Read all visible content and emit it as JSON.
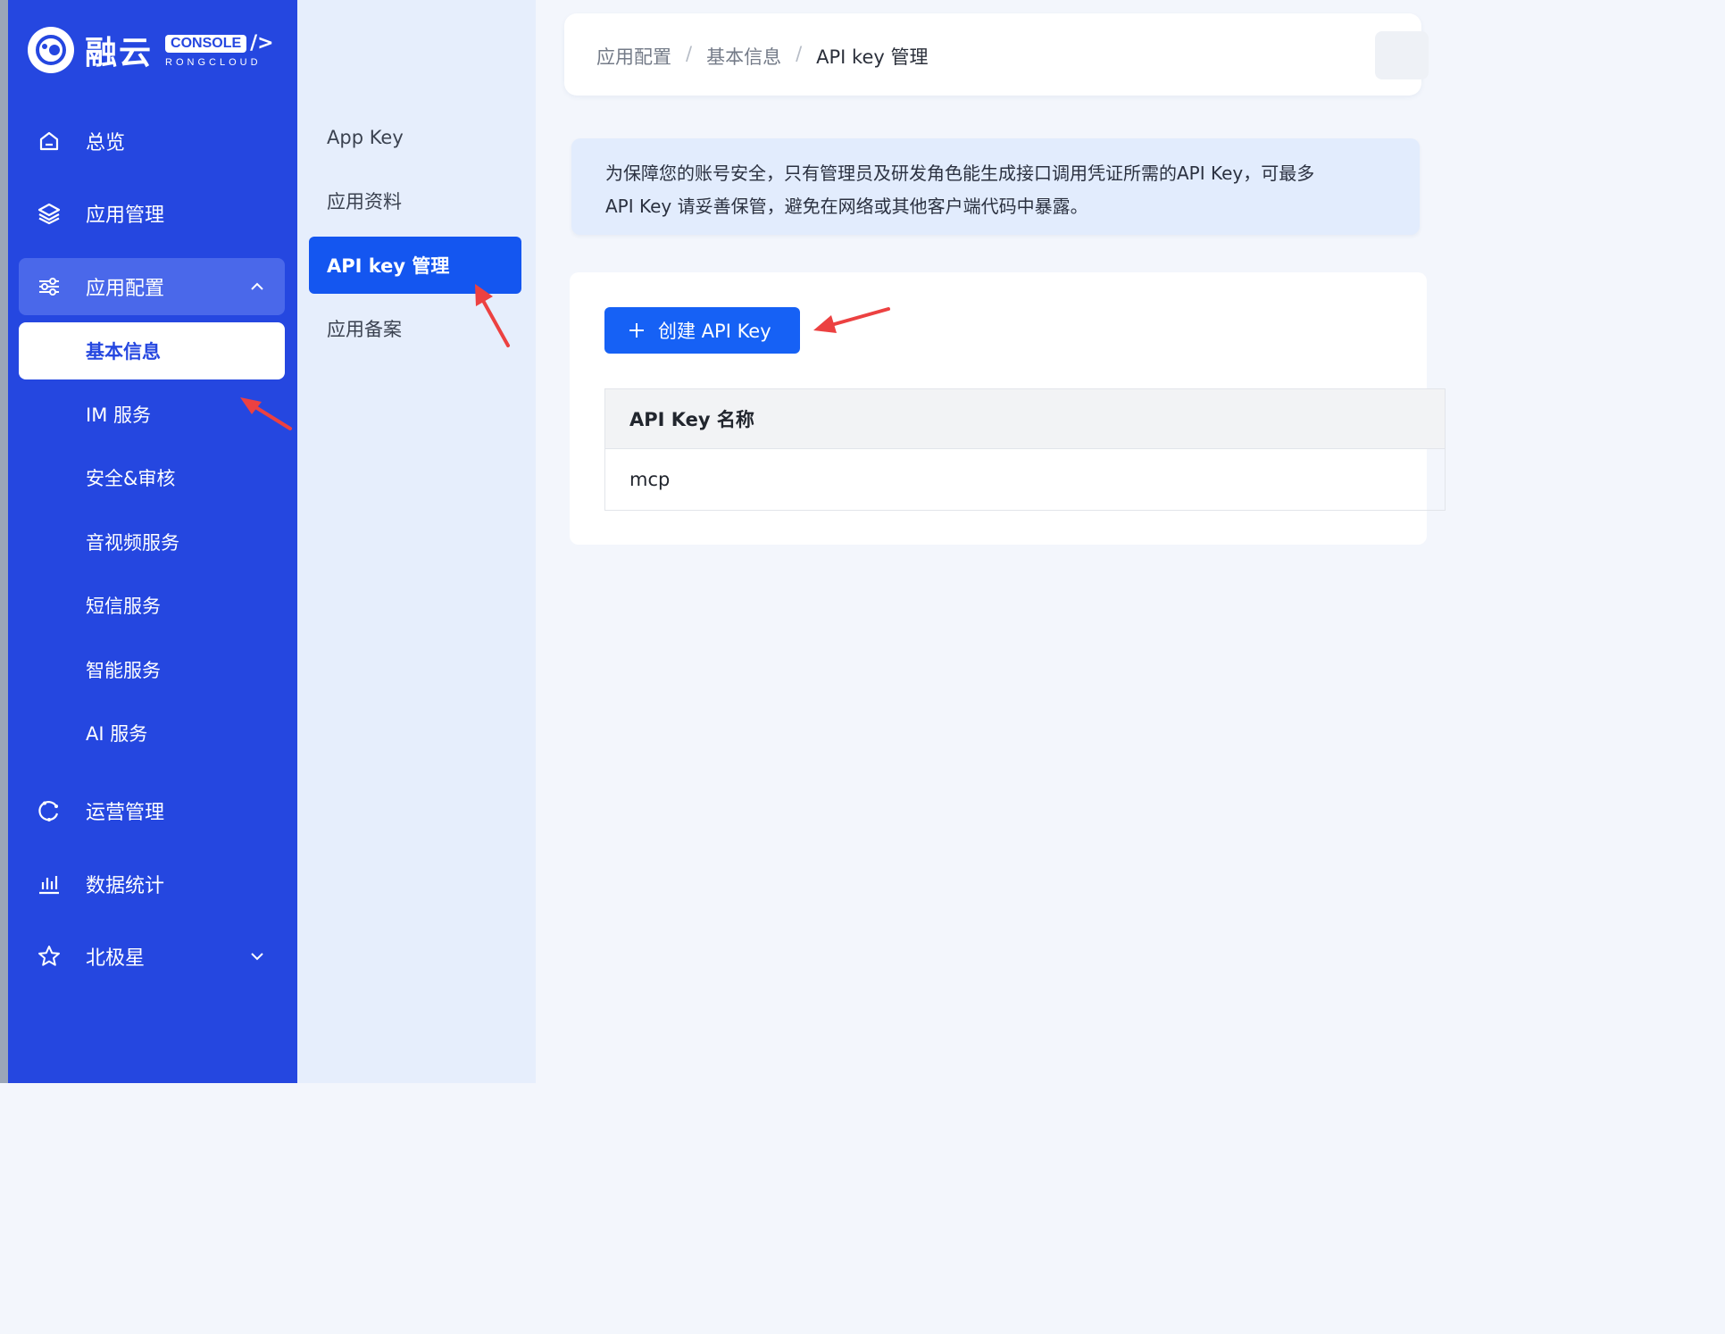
{
  "brand": {
    "name": "融云",
    "console_label": "CONSOLE",
    "console_sub": "RONGCLOUD"
  },
  "sidebar": {
    "items": [
      {
        "label": "总览",
        "icon": "home-icon"
      },
      {
        "label": "应用管理",
        "icon": "layers-icon"
      },
      {
        "label": "应用配置",
        "icon": "sliders-icon",
        "expanded": true
      },
      {
        "label": "运营管理",
        "icon": "refresh-icon"
      },
      {
        "label": "数据统计",
        "icon": "bar-chart-icon"
      },
      {
        "label": "北极星",
        "icon": "star-icon"
      }
    ],
    "sub_items": [
      {
        "label": "基本信息",
        "selected": true
      },
      {
        "label": "IM 服务"
      },
      {
        "label": "安全&审核"
      },
      {
        "label": "音视频服务"
      },
      {
        "label": "短信服务"
      },
      {
        "label": "智能服务"
      },
      {
        "label": "AI 服务"
      }
    ]
  },
  "secondary_nav": {
    "items": [
      {
        "label": "App Key"
      },
      {
        "label": "应用资料"
      },
      {
        "label": "API key 管理",
        "selected": true
      },
      {
        "label": "应用备案"
      }
    ]
  },
  "breadcrumb": {
    "items": [
      "应用配置",
      "基本信息",
      "API key 管理"
    ],
    "separator": "/"
  },
  "notice": {
    "line1": "为保障您的账号安全，只有管理员及研发角色能生成接口调用凭证所需的API Key，可最多",
    "line2": "API Key 请妥善保管，避免在网络或其他客户端代码中暴露。"
  },
  "actions": {
    "create_label": "创建 API Key"
  },
  "table": {
    "columns": [
      "API Key 名称"
    ],
    "rows": [
      [
        "mcp"
      ]
    ]
  },
  "colors": {
    "sidebar": "#2547e0",
    "primary": "#1661f5",
    "annotation_arrow": "#ec4141"
  }
}
